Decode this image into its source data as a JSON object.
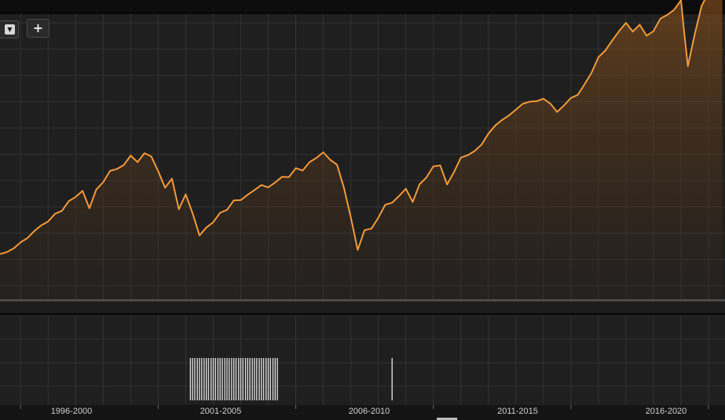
{
  "toolbar": {
    "dropdown_icon": "triangle-down-icon",
    "dropdown_glyph": "▼",
    "add_icon": "plus-icon",
    "add_glyph": "+"
  },
  "colors": {
    "line": "#f39a3a",
    "background": "#1f1f1f",
    "grid": "#333333",
    "volume_bar": "#d9d9d9"
  },
  "chart_data": [
    {
      "type": "area",
      "title": "",
      "xlabel": "",
      "ylabel": "",
      "grid": true,
      "legend": "none",
      "x_range": [
        1995.25,
        2021.6
      ],
      "y_range": [
        0,
        100
      ],
      "x": [
        1995.25,
        1995.5,
        1995.75,
        1996.0,
        1996.25,
        1996.5,
        1996.75,
        1997.0,
        1997.25,
        1997.5,
        1997.75,
        1998.0,
        1998.25,
        1998.5,
        1998.75,
        1999.0,
        1999.25,
        1999.5,
        1999.75,
        2000.0,
        2000.25,
        2000.5,
        2000.75,
        2001.0,
        2001.25,
        2001.5,
        2001.75,
        2002.0,
        2002.25,
        2002.5,
        2002.75,
        2003.0,
        2003.25,
        2003.5,
        2003.75,
        2004.0,
        2004.25,
        2004.5,
        2004.75,
        2005.0,
        2005.25,
        2005.5,
        2005.75,
        2006.0,
        2006.25,
        2006.5,
        2006.75,
        2007.0,
        2007.25,
        2007.5,
        2007.75,
        2008.0,
        2008.25,
        2008.5,
        2008.75,
        2009.0,
        2009.25,
        2009.5,
        2009.75,
        2010.0,
        2010.25,
        2010.5,
        2010.75,
        2011.0,
        2011.25,
        2011.5,
        2011.75,
        2012.0,
        2012.25,
        2012.5,
        2012.75,
        2013.0,
        2013.25,
        2013.5,
        2013.75,
        2014.0,
        2014.25,
        2014.5,
        2014.75,
        2015.0,
        2015.25,
        2015.5,
        2015.75,
        2016.0,
        2016.25,
        2016.5,
        2016.75,
        2017.0,
        2017.25,
        2017.5,
        2017.75,
        2018.0,
        2018.25,
        2018.5,
        2018.75,
        2019.0,
        2019.25,
        2019.5,
        2019.75,
        2020.0,
        2020.1,
        2020.25,
        2020.5,
        2020.75,
        2021.0,
        2021.25,
        2021.5
      ],
      "y": [
        9.6,
        10.4,
        11.8,
        14.1,
        15.7,
        18.4,
        20.5,
        22.0,
        24.9,
        26.0,
        29.7,
        31.3,
        33.6,
        27.0,
        34.1,
        36.9,
        41.2,
        41.9,
        43.4,
        47.0,
        44.5,
        47.9,
        46.6,
        41.0,
        34.8,
        38.2,
        26.6,
        32.3,
        25.1,
        16.7,
        19.7,
        21.7,
        25.3,
        26.4,
        30.0,
        30.1,
        32.1,
        33.9,
        35.8,
        34.9,
        36.8,
        38.9,
        38.8,
        42.2,
        41.3,
        44.5,
        46.1,
        48.2,
        45.4,
        43.5,
        34.7,
        23.6,
        11.2,
        18.7,
        19.3,
        23.4,
        28.3,
        29.1,
        31.6,
        34.4,
        29.4,
        36.1,
        38.7,
        42.9,
        43.2,
        36.0,
        40.7,
        46.2,
        47.1,
        48.7,
        51.1,
        55.3,
        58.4,
        60.5,
        62.2,
        64.4,
        66.6,
        67.4,
        67.6,
        68.5,
        66.7,
        63.5,
        66.0,
        68.8,
        70.0,
        74.1,
        78.4,
        84.3,
        86.8,
        90.6,
        94.1,
        97.3,
        94.0,
        96.6,
        92.4,
        94.1,
        98.9,
        100.3,
        102.2,
        105.9,
        95.2,
        80.9,
        93.0,
        103.7,
        108.9,
        109.3,
        108.7
      ]
    },
    {
      "type": "bar",
      "title": "",
      "xlabel": "",
      "ylabel": "",
      "grid": true,
      "legend": "none",
      "bars_x": [
        2002.17,
        2002.25,
        2002.33,
        2002.42,
        2002.5,
        2002.58,
        2002.67,
        2002.75,
        2002.83,
        2002.92,
        2003.0,
        2003.08,
        2003.17,
        2003.25,
        2003.33,
        2003.42,
        2003.5,
        2003.58,
        2003.67,
        2003.75,
        2003.83,
        2003.92,
        2004.0,
        2004.08,
        2004.17,
        2004.25,
        2004.33,
        2004.42,
        2004.5,
        2004.58,
        2004.67,
        2004.75,
        2004.83,
        2004.92,
        2005.0,
        2005.08,
        2005.17,
        2005.25,
        2005.33,
        2009.5
      ],
      "bars_value": [
        1,
        1,
        1,
        1,
        1,
        1,
        1,
        1,
        1,
        1,
        1,
        1,
        1,
        1,
        1,
        1,
        1,
        1,
        1,
        1,
        1,
        1,
        1,
        1,
        1,
        1,
        1,
        1,
        1,
        1,
        1,
        1,
        1,
        1,
        1,
        1,
        1,
        1,
        1,
        1
      ],
      "tick_labels": [
        "1996-2000",
        "2001-2005",
        "2006-2010",
        "2011-2015",
        "2016-2020"
      ]
    }
  ]
}
